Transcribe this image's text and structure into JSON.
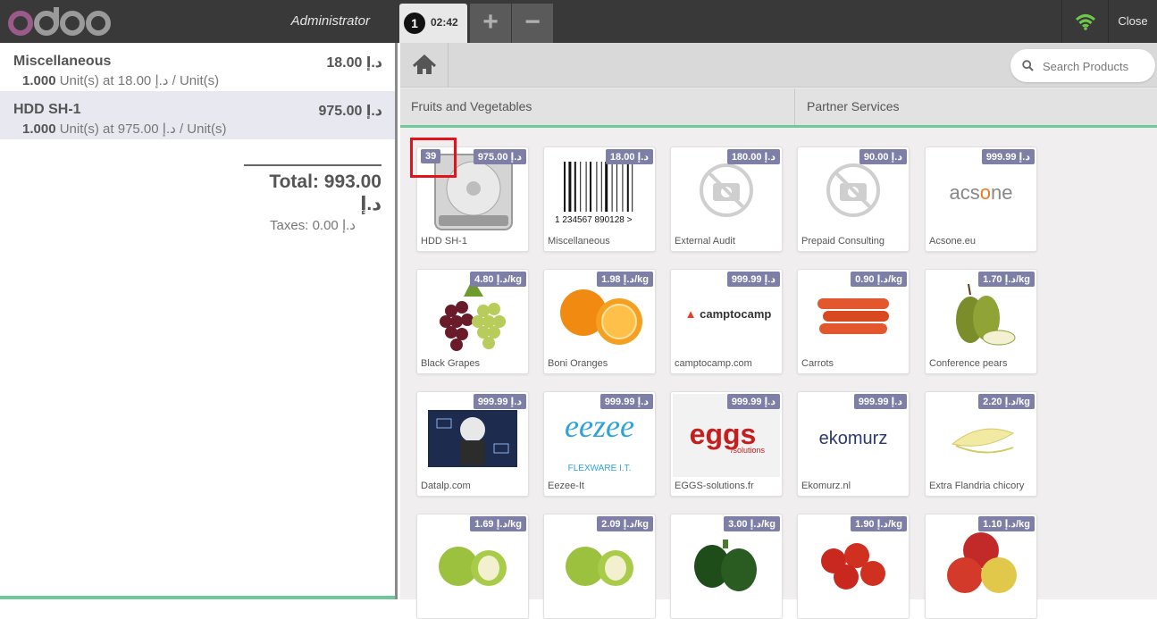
{
  "header": {
    "cashier": "Administrator",
    "order_tab": {
      "sequence": "1",
      "time": "02:42"
    },
    "add_order_label": "+",
    "remove_order_label": "−",
    "close_label": "Close",
    "wifi_color": "#6ec84a"
  },
  "order": {
    "lines": [
      {
        "name": "Miscellaneous",
        "price": "18.00 د.إ",
        "qty": "1.000",
        "info": " Unit(s) at 18.00 د.إ / Unit(s)",
        "selected": false
      },
      {
        "name": "HDD SH-1",
        "price": "975.00 د.إ",
        "qty": "1.000",
        "info": " Unit(s) at 975.00 د.إ / Unit(s)",
        "selected": true
      }
    ],
    "total": "Total: 993.00 د.إ",
    "taxes": "Taxes: 0.00 د.إ"
  },
  "search": {
    "placeholder": "Search Products"
  },
  "categories": [
    "Fruits and Vegetables",
    "Partner Services"
  ],
  "products": [
    {
      "name": "HDD SH-1",
      "price": "975.00 د.إ",
      "image": "hdd-icon",
      "qty_badge": "39"
    },
    {
      "name": "Miscellaneous",
      "price": "18.00 د.إ",
      "image": "barcode-icon",
      "barcode_text": "1 234567 890128 >"
    },
    {
      "name": "External Audit",
      "price": "180.00 د.إ",
      "image": "no-photo-icon"
    },
    {
      "name": "Prepaid Consulting",
      "price": "90.00 د.إ",
      "image": "no-photo-icon"
    },
    {
      "name": "Acsone.eu",
      "price": "999.99 د.إ",
      "image": "logo",
      "logo_text": "acsone"
    },
    {
      "name": "Black Grapes",
      "price": "4.80 د.إ/kg",
      "image": "grapes-icon"
    },
    {
      "name": "Boni Oranges",
      "price": "1.98 د.إ/kg",
      "image": "orange-icon"
    },
    {
      "name": "camptocamp.com",
      "price": "999.99 د.إ",
      "image": "logo",
      "logo_text": "camptocamp"
    },
    {
      "name": "Carrots",
      "price": "0.90 د.إ/kg",
      "image": "carrot-icon"
    },
    {
      "name": "Conference pears",
      "price": "1.70 د.إ/kg",
      "image": "pear-icon"
    },
    {
      "name": "Datalp.com",
      "price": "999.99 د.إ",
      "image": "datalp-icon"
    },
    {
      "name": "Eezee-It",
      "price": "999.99 د.إ",
      "image": "logo",
      "logo_text": "eezee",
      "logo_sub": "FLEXWARE I.T."
    },
    {
      "name": "EGGS-solutions.fr",
      "price": "999.99 د.إ",
      "image": "logo",
      "logo_text": "eggs",
      "logo_sub": "/solutions"
    },
    {
      "name": "Ekomurz.nl",
      "price": "999.99 د.إ",
      "image": "logo",
      "logo_text": "ekomurz"
    },
    {
      "name": "Extra Flandria chicory",
      "price": "2.20 د.إ/kg",
      "image": "chicory-icon"
    },
    {
      "name": "",
      "price": "1.69 د.إ/kg",
      "image": "green-apple-icon"
    },
    {
      "name": "",
      "price": "2.09 د.إ/kg",
      "image": "green-apple-icon"
    },
    {
      "name": "",
      "price": "3.00 د.إ/kg",
      "image": "pepper-icon"
    },
    {
      "name": "",
      "price": "1.90 د.إ/kg",
      "image": "tomato-icon"
    },
    {
      "name": "",
      "price": "1.10 د.إ/kg",
      "image": "red-apple-icon"
    }
  ],
  "colors": {
    "price_badge": "#7d7fa6",
    "accent_green": "#6ec89b",
    "selected_line": "#e8e9f0",
    "highlight_box": "#e0141a"
  }
}
